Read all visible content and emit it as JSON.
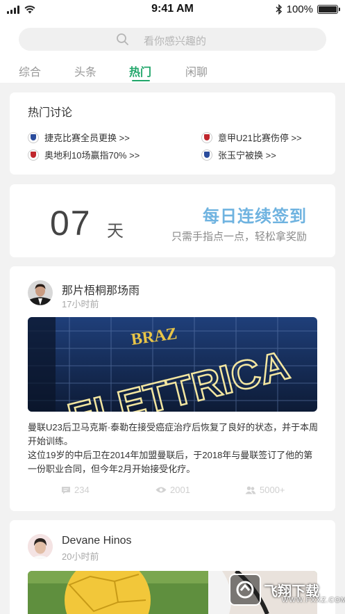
{
  "status_bar": {
    "time": "9:41 AM",
    "battery": "100%"
  },
  "search": {
    "placeholder": "看你感兴趣的"
  },
  "tabs": [
    {
      "label": "综合"
    },
    {
      "label": "头条"
    },
    {
      "label": "热门",
      "active": true
    },
    {
      "label": "闲聊"
    }
  ],
  "hot_topics": {
    "title": "热门讨论",
    "items": [
      {
        "label": "捷克比赛全员更换 >>",
        "badge_color": "#2a4c9c"
      },
      {
        "label": "意甲U21比赛伤停 >>",
        "badge_color": "#c0272d"
      },
      {
        "label": "奥地利10场赢指70% >>",
        "badge_color": "#c0272d"
      },
      {
        "label": "张玉宁被换 >>",
        "badge_color": "#2a4c9c"
      }
    ]
  },
  "checkin": {
    "days": "07",
    "unit": "天",
    "title": "每日连续签到",
    "subtitle": "只需手指点一点，轻松拿奖励"
  },
  "posts": [
    {
      "author": "那片梧桐那场雨",
      "time": "17小时前",
      "image_sign_text": "ELETTRICA",
      "image_top_text": "BRAZ",
      "paragraphs": [
        "曼联U23后卫马克斯·泰勒在接受癌症治疗后恢复了良好的状态，并于本周开始训练。",
        "这位19岁的中后卫在2014年加盟曼联后，于2018年与曼联签订了他的第一份职业合同，但今年2月开始接受化疗。"
      ],
      "comments": "234",
      "views": "2001",
      "likes": "5000+"
    },
    {
      "author": "Devane Hinos",
      "time": "20小时前"
    }
  ],
  "watermark": {
    "brand": "飞翔下载",
    "url": "WWW.FXXZ.COM"
  },
  "colors": {
    "accent": "#20a66a",
    "checkin_title": "#6fb3e0",
    "background": "#f2f2f2"
  }
}
